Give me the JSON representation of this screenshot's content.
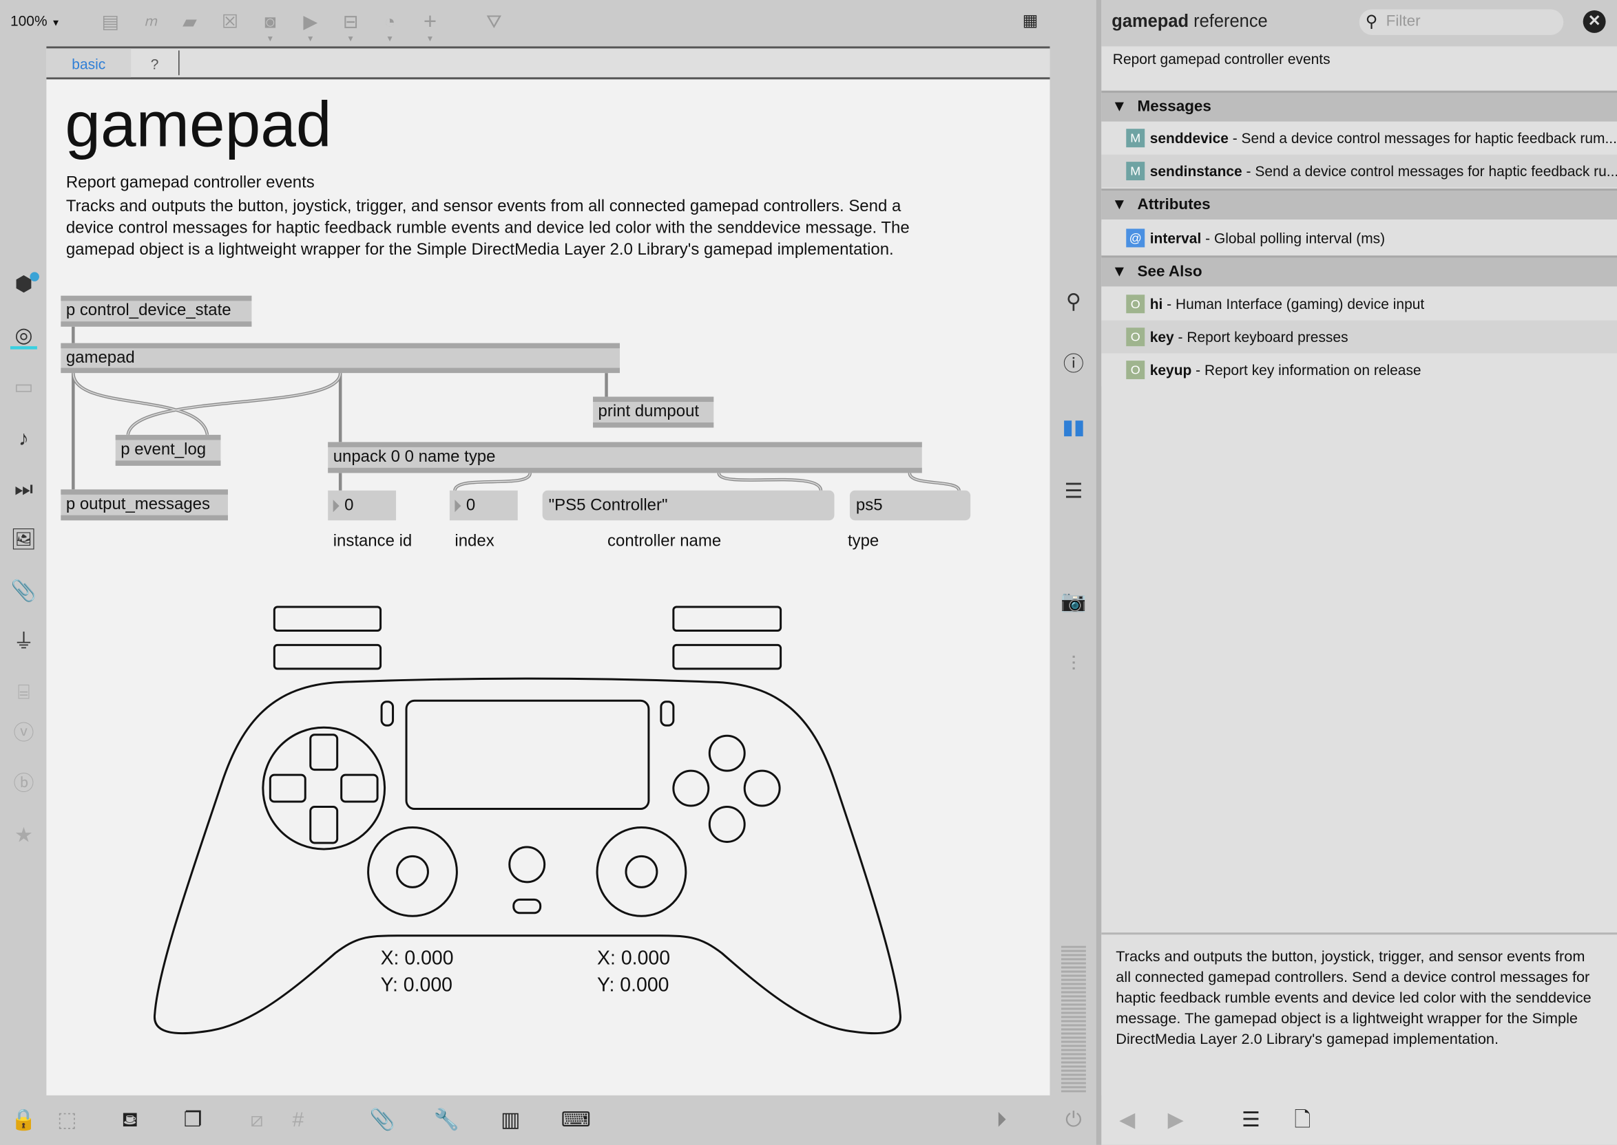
{
  "toolbar": {
    "zoom": "100%",
    "icons": [
      "object-box-icon",
      "message-box-icon",
      "comment-icon",
      "toggle-icon",
      "button-icon",
      "number-icon",
      "slider-icon",
      "dial-icon",
      "add-icon",
      "paint-bucket-icon",
      "grid-icon"
    ]
  },
  "tabs": [
    {
      "label": "basic"
    },
    {
      "label": "?"
    }
  ],
  "help": {
    "title": "gamepad",
    "subtitle": "Report gamepad controller events",
    "description_lines": [
      "Tracks and outputs the button, joystick, trigger, and sensor events from all connected gamepad controllers. Send a",
      "device control messages for haptic feedback rumble events and device led color with the senddevice message. The",
      "gamepad object is a lightweight wrapper for the Simple DirectMedia Layer 2.0 Library's gamepad implementation."
    ]
  },
  "patch": {
    "objects": {
      "control_device_state": "p control_device_state",
      "gamepad": "gamepad",
      "print": "print dumpout",
      "event_log": "p event_log",
      "unpack": "unpack 0 0 name type",
      "output_messages": "p output_messages"
    },
    "outputs": {
      "instance_id": "0",
      "index": "0",
      "controller_name": "\"PS5 Controller\"",
      "type": "ps5"
    },
    "labels": {
      "instance_id": "instance id",
      "index": "index",
      "controller_name": "controller name",
      "type": "type"
    },
    "controller": {
      "left_x": "X: 0.000",
      "left_y": "Y: 0.000",
      "right_x": "X: 0.000",
      "right_y": "Y: 0.000"
    }
  },
  "reference": {
    "title_bold": "gamepad",
    "title_rest": "reference",
    "filter_placeholder": "Filter",
    "digest": "Report gamepad controller events",
    "sections": {
      "messages": {
        "label": "Messages",
        "items": [
          {
            "name": "senddevice",
            "desc": " - Send a device control messages for haptic feedback rum..."
          },
          {
            "name": "sendinstance",
            "desc": " - Send a device control messages for haptic feedback ru..."
          }
        ]
      },
      "attributes": {
        "label": "Attributes",
        "items": [
          {
            "name": "interval",
            "desc": " - Global polling interval (ms)"
          }
        ]
      },
      "see_also": {
        "label": "See Also",
        "items": [
          {
            "name": "hi",
            "desc": " - Human Interface (gaming) device input"
          },
          {
            "name": "key",
            "desc": " - Report keyboard presses"
          },
          {
            "name": "keyup",
            "desc": " - Report key information on release"
          }
        ]
      }
    },
    "badges": {
      "message": "M",
      "attribute": "@",
      "object": "O"
    },
    "description": "Tracks and outputs the button, joystick, trigger, and sensor events from all connected gamepad controllers. Send a device control messages for haptic feedback rumble events and device led color with the senddevice message. The gamepad object is a lightweight wrapper for the Simple DirectMedia Layer 2.0 Library's gamepad implementation."
  },
  "colors": {
    "accent": "#2f7fd6",
    "message_badge": "#6fa3a3",
    "attribute_badge": "#4a90e2",
    "object_badge": "#9fb48e"
  }
}
